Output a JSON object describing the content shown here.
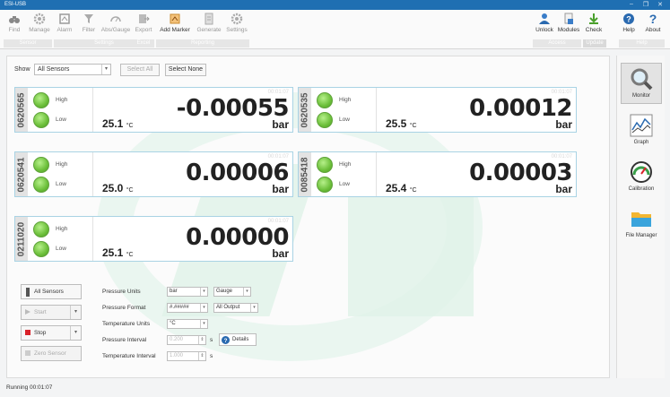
{
  "window": {
    "title": "ESI-USB",
    "controls": {
      "minimize": "–",
      "maximize": "❐",
      "close": "✕"
    }
  },
  "ribbon": {
    "buttons": [
      {
        "id": "find",
        "label": "Find",
        "icon": "binoculars-icon",
        "enabled": false
      },
      {
        "id": "manage",
        "label": "Manage",
        "icon": "gear-icon",
        "enabled": false
      },
      {
        "id": "alarm",
        "label": "Alarm",
        "icon": "alarm-icon",
        "enabled": false
      },
      {
        "id": "filter",
        "label": "Filter",
        "icon": "filter-icon",
        "enabled": false
      },
      {
        "id": "absgauge",
        "label": "Abs/Gauge",
        "icon": "gauge-icon",
        "enabled": false
      },
      {
        "id": "export",
        "label": "Export",
        "icon": "export-icon",
        "enabled": false
      },
      {
        "id": "add_marker",
        "label": "Add Marker",
        "icon": "marker-icon",
        "enabled": true
      },
      {
        "id": "generate",
        "label": "Generate",
        "icon": "document-icon",
        "enabled": false
      },
      {
        "id": "settings",
        "label": "Settings",
        "icon": "gear-icon",
        "enabled": false
      },
      {
        "id": "unlock",
        "label": "Unlock",
        "icon": "users-icon",
        "enabled": true
      },
      {
        "id": "modules",
        "label": "Modules",
        "icon": "modules-icon",
        "enabled": true
      },
      {
        "id": "check",
        "label": "Check",
        "icon": "download-icon",
        "enabled": true
      },
      {
        "id": "help",
        "label": "Help",
        "icon": "help-icon",
        "enabled": true
      },
      {
        "id": "about",
        "label": "About",
        "icon": "question-icon",
        "enabled": true
      }
    ],
    "groups": [
      "Sensor",
      "Settings",
      "Excel",
      "Reporting",
      "Access",
      "Update",
      "Help"
    ]
  },
  "toolbar": {
    "show_label": "Show",
    "show_value": "All Sensors",
    "select_all": "Select All",
    "select_none": "Select None"
  },
  "sensors": [
    {
      "id": "0620565",
      "high": "High",
      "low": "Low",
      "elapsed": "00:01:07",
      "reading": "-0.00055",
      "unit": "bar",
      "temp": "25.1",
      "temp_unit": "°C"
    },
    {
      "id": "0620535",
      "high": "High",
      "low": "Low",
      "elapsed": "00:01:07",
      "reading": "0.00012",
      "unit": "bar",
      "temp": "25.5",
      "temp_unit": "°C"
    },
    {
      "id": "0620541",
      "high": "High",
      "low": "Low",
      "elapsed": "00:01:07",
      "reading": "0.00006",
      "unit": "bar",
      "temp": "25.0",
      "temp_unit": "°C"
    },
    {
      "id": "0085418",
      "high": "High",
      "low": "Low",
      "elapsed": "00:01:07",
      "reading": "0.00003",
      "unit": "bar",
      "temp": "25.4",
      "temp_unit": "°C"
    },
    {
      "id": "0211020",
      "high": "High",
      "low": "Low",
      "elapsed": "00:01:07",
      "reading": "0.00000",
      "unit": "bar",
      "temp": "25.1",
      "temp_unit": "°C"
    }
  ],
  "controls": {
    "all_sensors": "All Sensors",
    "start": "Start",
    "stop": "Stop",
    "zero_sensor": "Zero Sensor",
    "pressure_units_label": "Pressure Units",
    "pressure_units": "bar",
    "pressure_type": "Gauge",
    "pressure_format_label": "Pressure Format",
    "pressure_format": "#.#####",
    "output": "All Output",
    "temperature_units_label": "Temperature Units",
    "temperature_units": "°C",
    "pressure_interval_label": "Pressure Interval",
    "pressure_interval": "0.200",
    "pressure_interval_unit": "s",
    "details": "Details",
    "temperature_interval_label": "Temperature Interval",
    "temperature_interval": "1.000",
    "temperature_interval_unit": "s"
  },
  "sidebar": {
    "items": [
      {
        "label": "Monitor",
        "active": true
      },
      {
        "label": "Graph",
        "active": false
      },
      {
        "label": "Calibration",
        "active": false
      },
      {
        "label": "File Manager",
        "active": false
      }
    ]
  },
  "status": {
    "text": "Running 00:01:07"
  },
  "colors": {
    "accent": "#1f6fb2",
    "card_border": "#a9d3e4",
    "led_green": "#6cbf3a",
    "stop_red": "#d9222a"
  }
}
